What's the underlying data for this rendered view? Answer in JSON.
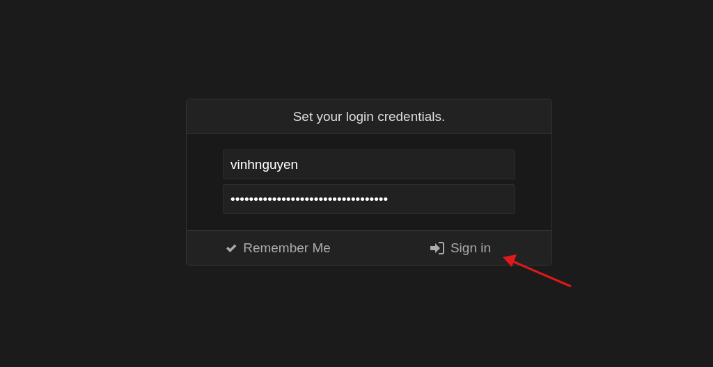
{
  "dialog": {
    "title": "Set your login credentials.",
    "username": {
      "value": "vinhnguyen"
    },
    "password": {
      "value": "••••••••••••••••••••••••••••••••••"
    },
    "remember": {
      "label": "Remember Me",
      "checked": true
    },
    "sign_in": {
      "label": "Sign in"
    }
  }
}
